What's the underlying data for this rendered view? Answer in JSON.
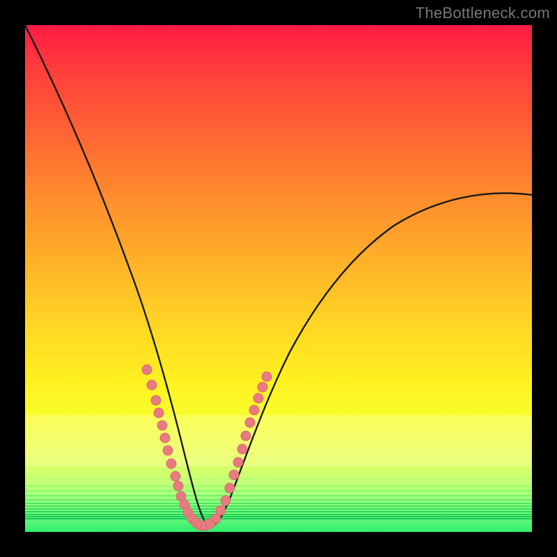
{
  "watermark": "TheBottleneck.com",
  "colors": {
    "frame": "#000000",
    "curve_stroke": "#181818",
    "dot_fill": "#e77b7f",
    "dot_stroke": "#d86a6e"
  },
  "chart_data": {
    "type": "line",
    "title": "",
    "xlabel": "",
    "ylabel": "",
    "xlim": [
      0,
      100
    ],
    "ylim": [
      0,
      100
    ],
    "grid": false,
    "legend": false,
    "annotations": [
      "TheBottleneck.com"
    ],
    "series": [
      {
        "name": "bottleneck-curve",
        "x": [
          0,
          4,
          8,
          12,
          16,
          20,
          22,
          24,
          26,
          28,
          30,
          31,
          32,
          33,
          34,
          35,
          36,
          38,
          40,
          42,
          44,
          46,
          48,
          50,
          54,
          58,
          62,
          66,
          70,
          76,
          82,
          88,
          94,
          100
        ],
        "y": [
          100,
          92,
          84,
          76,
          67,
          57,
          51,
          45,
          38,
          30,
          21,
          16,
          11,
          7,
          4,
          2,
          1,
          1,
          3,
          7,
          12,
          18,
          23,
          28,
          35,
          41,
          46,
          50,
          53,
          57,
          60,
          62,
          64,
          65
        ]
      },
      {
        "name": "highlight-dots",
        "x": [
          24.0,
          25.0,
          25.8,
          26.4,
          27.0,
          27.6,
          28.2,
          28.8,
          29.6,
          30.2,
          30.8,
          31.4,
          32.2,
          33.0,
          33.8,
          34.6,
          35.6,
          36.6,
          37.6,
          38.6,
          39.6,
          40.4,
          41.2,
          42.0,
          42.8,
          43.6,
          44.4,
          45.2,
          46.0,
          46.8,
          47.6
        ],
        "y": [
          32.0,
          29.0,
          26.0,
          23.5,
          21.0,
          18.5,
          16.0,
          13.5,
          11.0,
          9.0,
          7.0,
          5.3,
          3.8,
          2.6,
          1.8,
          1.3,
          1.2,
          1.6,
          2.6,
          4.2,
          6.2,
          8.6,
          11.2,
          13.8,
          16.4,
          19.0,
          21.6,
          24.0,
          26.4,
          28.6,
          30.6
        ]
      }
    ],
    "bands": {
      "wide_yellow": {
        "y_top": 23,
        "y_bottom": 13
      },
      "green_stripes_y": [
        10.5,
        9.2,
        8.2,
        7.3,
        6.5,
        5.8,
        5.2,
        4.6,
        4.1,
        3.6,
        3.1,
        2.7
      ]
    }
  }
}
